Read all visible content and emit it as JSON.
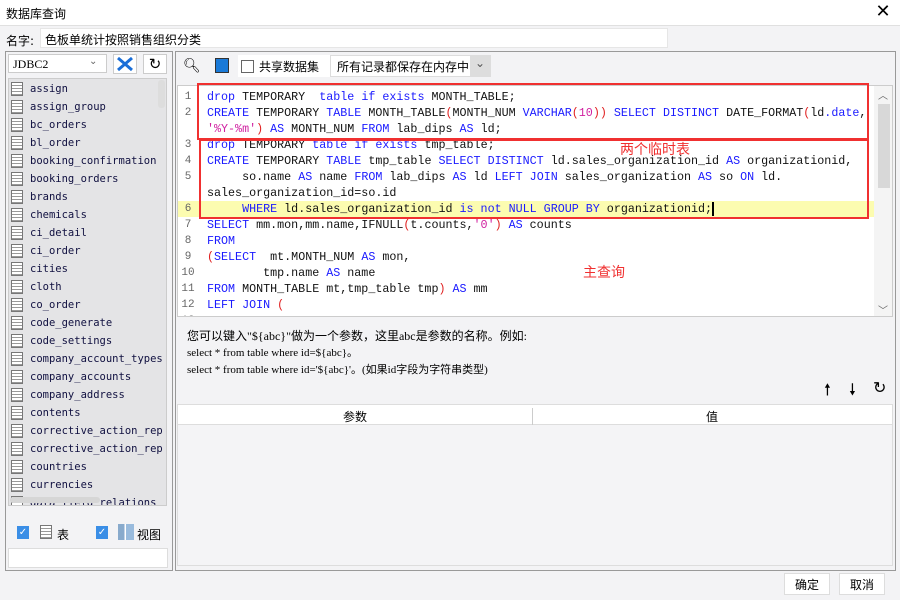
{
  "window": {
    "title": "数据库查询",
    "close": "✕"
  },
  "name": {
    "label": "名字:",
    "value": "色板单统计按照销售组织分类"
  },
  "left": {
    "connection": "JDBC2",
    "tables": [
      "assign",
      "assign_group",
      "bc_orders",
      "bl_order",
      "booking_confirmation",
      "booking_orders",
      "brands",
      "chemicals",
      "ci_detail",
      "ci_order",
      "cities",
      "cloth",
      "co_order",
      "code_generate",
      "code_settings",
      "company_account_types",
      "company_accounts",
      "company_address",
      "contents",
      "corrective_action_rep",
      "corrective_action_rep",
      "countries",
      "currencies",
      "data_field_relations"
    ],
    "show_tables_label": "表",
    "show_views_label": "视图"
  },
  "toolbar": {
    "share_label": "共享数据集",
    "storage_mode": "所有记录都保存在内存中"
  },
  "editor": {
    "rows": [
      {
        "n": "1",
        "t": [
          [
            "k",
            "drop"
          ],
          [
            "n",
            " TEMPORARY  "
          ],
          [
            "k",
            "table"
          ],
          [
            "n",
            " "
          ],
          [
            "k",
            "if"
          ],
          [
            "n",
            " "
          ],
          [
            "k",
            "exists"
          ],
          [
            "n",
            " MONTH_TABLE;"
          ]
        ]
      },
      {
        "n": "2",
        "t": [
          [
            "k",
            "CREATE"
          ],
          [
            "n",
            " TEMPORARY "
          ],
          [
            "k",
            "TABLE"
          ],
          [
            "n",
            " MONTH_TABLE"
          ],
          [
            "p",
            "("
          ],
          [
            "n",
            "MONTH_NUM "
          ],
          [
            "k",
            "VARCHAR"
          ],
          [
            "p",
            "("
          ],
          [
            "s",
            "10"
          ],
          [
            "p",
            "))"
          ],
          [
            "n",
            " "
          ],
          [
            "k",
            "SELECT DISTINCT"
          ],
          [
            "n",
            " DATE_FORMAT"
          ],
          [
            "p",
            "("
          ],
          [
            "n",
            "ld"
          ],
          [
            "k",
            "."
          ],
          [
            "k",
            "date"
          ],
          [
            "n",
            ","
          ]
        ]
      },
      {
        "n": "",
        "t": [
          [
            "s",
            "'%Y-%m'"
          ],
          [
            "p",
            ")"
          ],
          [
            "n",
            " "
          ],
          [
            "k",
            "AS"
          ],
          [
            "n",
            " MONTH_NUM "
          ],
          [
            "k",
            "FROM"
          ],
          [
            "n",
            " lab_dips "
          ],
          [
            "k",
            "AS"
          ],
          [
            "n",
            " ld;"
          ]
        ]
      },
      {
        "n": "3",
        "t": [
          [
            "k",
            "drop"
          ],
          [
            "n",
            " TEMPORARY "
          ],
          [
            "k",
            "table"
          ],
          [
            "n",
            " "
          ],
          [
            "k",
            "if"
          ],
          [
            "n",
            " "
          ],
          [
            "k",
            "exists"
          ],
          [
            "n",
            " tmp_table;"
          ]
        ]
      },
      {
        "n": "4",
        "t": [
          [
            "k",
            "CREATE"
          ],
          [
            "n",
            " TEMPORARY "
          ],
          [
            "k",
            "TABLE"
          ],
          [
            "n",
            " tmp_table "
          ],
          [
            "k",
            "SELECT DISTINCT"
          ],
          [
            "n",
            " ld.sales_organization_id "
          ],
          [
            "k",
            "AS"
          ],
          [
            "n",
            " organizationid,"
          ]
        ]
      },
      {
        "n": "5",
        "t": [
          [
            "n",
            "     so.name "
          ],
          [
            "k",
            "AS"
          ],
          [
            "n",
            " name "
          ],
          [
            "k",
            "FROM"
          ],
          [
            "n",
            " lab_dips "
          ],
          [
            "k",
            "AS"
          ],
          [
            "n",
            " ld "
          ],
          [
            "k",
            "LEFT JOIN"
          ],
          [
            "n",
            " sales_organization "
          ],
          [
            "k",
            "AS"
          ],
          [
            "n",
            " so "
          ],
          [
            "k",
            "ON"
          ],
          [
            "n",
            " ld."
          ]
        ]
      },
      {
        "n": "",
        "t": [
          [
            "n",
            "sales_organization_id=so.id"
          ]
        ]
      },
      {
        "n": "6",
        "hl": true,
        "t": [
          [
            "n",
            "     "
          ],
          [
            "k",
            "WHERE"
          ],
          [
            "n",
            " ld.sales_organization_id "
          ],
          [
            "k",
            "is not NULL GROUP BY"
          ],
          [
            "n",
            " organizationid;"
          ]
        ]
      },
      {
        "n": "7",
        "t": [
          [
            "k",
            "SELECT"
          ],
          [
            "n",
            " mm.mon,mm.name,IFNULL"
          ],
          [
            "p",
            "("
          ],
          [
            "n",
            "t.counts,"
          ],
          [
            "s",
            "'0'"
          ],
          [
            "p",
            ")"
          ],
          [
            "n",
            " "
          ],
          [
            "k",
            "AS"
          ],
          [
            "n",
            " counts"
          ]
        ]
      },
      {
        "n": "8",
        "t": [
          [
            "k",
            "FROM"
          ]
        ]
      },
      {
        "n": "9",
        "t": [
          [
            "p",
            "("
          ],
          [
            "k",
            "SELECT"
          ],
          [
            "n",
            "  mt.MONTH_NUM "
          ],
          [
            "k",
            "AS"
          ],
          [
            "n",
            " mon,"
          ]
        ]
      },
      {
        "n": "10",
        "t": [
          [
            "n",
            "        tmp.name "
          ],
          [
            "k",
            "AS"
          ],
          [
            "n",
            " name"
          ]
        ]
      },
      {
        "n": "11",
        "t": [
          [
            "k",
            "FROM"
          ],
          [
            "n",
            " MONTH_TABLE mt,tmp_table tmp"
          ],
          [
            "p",
            ")"
          ],
          [
            "n",
            " "
          ],
          [
            "k",
            "AS"
          ],
          [
            "n",
            " mm"
          ]
        ]
      },
      {
        "n": "12",
        "t": [
          [
            "k",
            "LEFT JOIN"
          ],
          [
            "n",
            " "
          ],
          [
            "p",
            "("
          ]
        ]
      },
      {
        "n": "13",
        "t": [
          [
            "k",
            "SELECT"
          ]
        ]
      }
    ]
  },
  "annotations": {
    "temp_tables": "两个临时表",
    "main_query": "主查询"
  },
  "hint": {
    "line1": "您可以键入\"${abc}\"做为一个参数，这里abc是参数的名称。例如:",
    "line2": "select * from table where id=${abc}。",
    "line3": "select * from table where id='${abc}'。(如果id字段为字符串类型)"
  },
  "params": {
    "col_param": "参数",
    "col_value": "值"
  },
  "buttons": {
    "ok": "确定",
    "cancel": "取消"
  }
}
